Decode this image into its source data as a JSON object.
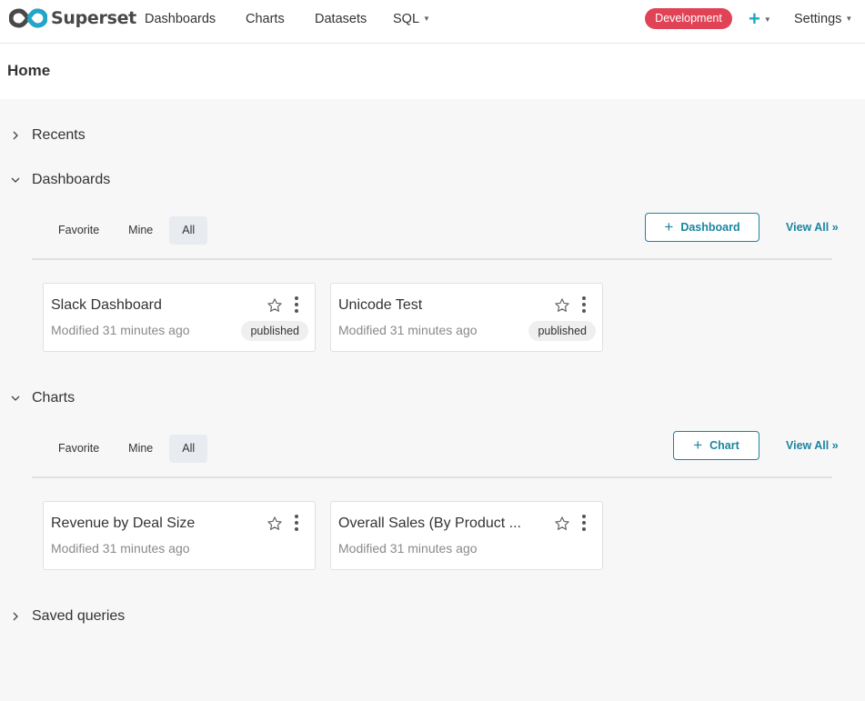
{
  "app": {
    "brand": "Superset"
  },
  "nav": {
    "items": [
      {
        "label": "Dashboards"
      },
      {
        "label": "Charts"
      },
      {
        "label": "Datasets"
      },
      {
        "label": "SQL"
      }
    ],
    "env_badge": "Development",
    "plus_label": "+",
    "settings_label": "Settings"
  },
  "page": {
    "title": "Home"
  },
  "sections": {
    "recents": {
      "label": "Recents"
    },
    "dashboards": {
      "label": "Dashboards",
      "tabs": [
        "Favorite",
        "Mine",
        "All"
      ],
      "active_tab": "All",
      "add_button": "Dashboard",
      "view_all": "View All »",
      "cards": [
        {
          "title": "Slack Dashboard",
          "modified": "Modified 31 minutes ago",
          "status": "published"
        },
        {
          "title": "Unicode Test",
          "modified": "Modified 31 minutes ago",
          "status": "published"
        }
      ]
    },
    "charts": {
      "label": "Charts",
      "tabs": [
        "Favorite",
        "Mine",
        "All"
      ],
      "active_tab": "All",
      "add_button": "Chart",
      "view_all": "View All »",
      "cards": [
        {
          "title": "Revenue by Deal Size",
          "modified": "Modified 31 minutes ago"
        },
        {
          "title": "Overall Sales (By Product ...",
          "modified": "Modified 31 minutes ago"
        }
      ]
    },
    "saved_queries": {
      "label": "Saved queries"
    }
  },
  "colors": {
    "brand_accent": "#20a7c9",
    "primary": "#1a85a0",
    "env_badge": "#e04355"
  },
  "icons": [
    "superset-logo-icon",
    "chevron-right-icon",
    "chevron-down-icon",
    "plus-icon",
    "star-icon",
    "more-vertical-icon",
    "caret-down-icon"
  ]
}
